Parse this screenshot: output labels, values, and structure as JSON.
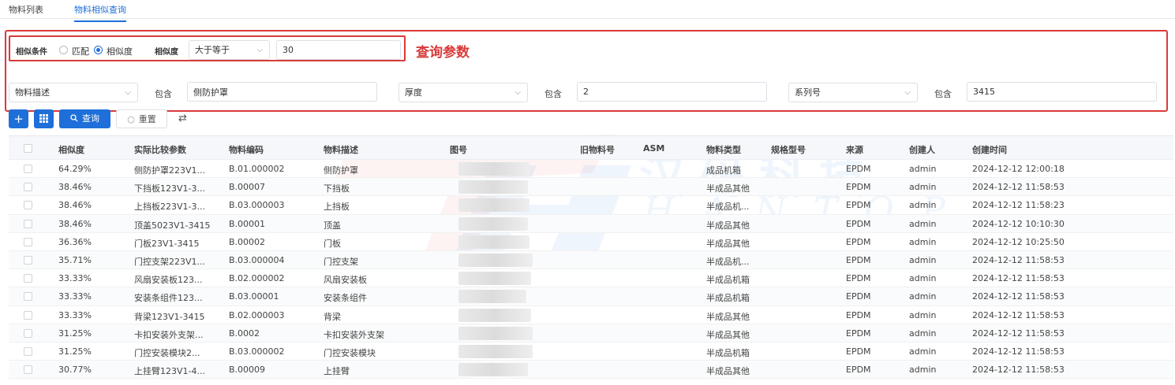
{
  "tabs": [
    {
      "label": "物料列表",
      "active": false
    },
    {
      "label": "物料相似查询",
      "active": true
    }
  ],
  "annotation": "查询参数",
  "similarity": {
    "condition_label": "相似条件",
    "option_match": "匹配",
    "option_similarity": "相似度",
    "selected": "相似度",
    "degree_label": "相似度",
    "operator": "大于等于",
    "value": "30"
  },
  "filters": [
    {
      "field": "物料描述",
      "op": "包含",
      "value": "侧防护罩"
    },
    {
      "field": "厚度",
      "op": "包含",
      "value": "2"
    },
    {
      "field": "系列号",
      "op": "包含",
      "value": "3415"
    }
  ],
  "toolbar": {
    "add_icon": "plus-icon",
    "grid_icon": "grid-icon",
    "query_label": "查询",
    "reset_label": "重置",
    "columns_icon": "sliders-icon"
  },
  "table": {
    "headers": [
      "相似度",
      "实际比较参数",
      "物料编码",
      "物料描述",
      "图号",
      "旧物料号",
      "ASM",
      "物料类型",
      "规格型号",
      "来源",
      "创建人",
      "创建时间"
    ],
    "rows": [
      {
        "sim": "64.29%",
        "param": "侧防护罩223V1...",
        "code": "B.01.000002",
        "desc": "侧防护罩",
        "type": "成品机箱",
        "src": "EPDM",
        "user": "admin",
        "time": "2024-12-12 12:00:18"
      },
      {
        "sim": "38.46%",
        "param": "下挡板123V1-3...",
        "code": "B.00007",
        "desc": "下挡板",
        "type": "半成品其他",
        "src": "EPDM",
        "user": "admin",
        "time": "2024-12-12 11:58:53"
      },
      {
        "sim": "38.46%",
        "param": "上挡板223V1-3...",
        "code": "B.03.000003",
        "desc": "上挡板",
        "type": "半成品机...",
        "src": "EPDM",
        "user": "admin",
        "time": "2024-12-12 11:58:23"
      },
      {
        "sim": "38.46%",
        "param": "顶盖5023V1-3415",
        "code": "B.00001",
        "desc": "顶盖",
        "type": "半成品其他",
        "src": "EPDM",
        "user": "admin",
        "time": "2024-12-12 10:10:30"
      },
      {
        "sim": "36.36%",
        "param": "门板23V1-3415",
        "code": "B.00002",
        "desc": "门板",
        "type": "半成品其他",
        "src": "EPDM",
        "user": "admin",
        "time": "2024-12-12 10:25:50"
      },
      {
        "sim": "35.71%",
        "param": "门控支架223V1...",
        "code": "B.03.000004",
        "desc": "门控支架",
        "type": "半成品机...",
        "src": "EPDM",
        "user": "admin",
        "time": "2024-12-12 11:58:53"
      },
      {
        "sim": "33.33%",
        "param": "风扇安装板123...",
        "code": "B.02.000002",
        "desc": "风扇安装板",
        "type": "半成品机箱",
        "src": "EPDM",
        "user": "admin",
        "time": "2024-12-12 11:58:53"
      },
      {
        "sim": "33.33%",
        "param": "安装条组件123...",
        "code": "B.03.00001",
        "desc": "安装条组件",
        "type": "半成品机箱",
        "src": "EPDM",
        "user": "admin",
        "time": "2024-12-12 11:58:53"
      },
      {
        "sim": "33.33%",
        "param": "背梁123V1-3415",
        "code": "B.02.000003",
        "desc": "背梁",
        "type": "半成品其他",
        "src": "EPDM",
        "user": "admin",
        "time": "2024-12-12 11:58:53"
      },
      {
        "sim": "31.25%",
        "param": "卡扣安装外支架...",
        "code": "B.0002",
        "desc": "卡扣安装外支架",
        "type": "半成品其他",
        "src": "EPDM",
        "user": "admin",
        "time": "2024-12-12 11:58:53"
      },
      {
        "sim": "31.25%",
        "param": "门控安装模块2...",
        "code": "B.03.000002",
        "desc": "门控安装模块",
        "type": "半成品机箱",
        "src": "EPDM",
        "user": "admin",
        "time": "2024-12-12 11:58:53"
      },
      {
        "sim": "30.77%",
        "param": "上挂臂123V1-4...",
        "code": "B.00009",
        "desc": "上挂臂",
        "type": "半成品其他",
        "src": "EPDM",
        "user": "admin",
        "time": "2024-12-12 11:58:53"
      }
    ]
  },
  "watermark": {
    "line1": "汉码科技",
    "line2": "HANTOP"
  },
  "colors": {
    "primary": "#1e6fd9",
    "annotation": "#d93a3a"
  }
}
